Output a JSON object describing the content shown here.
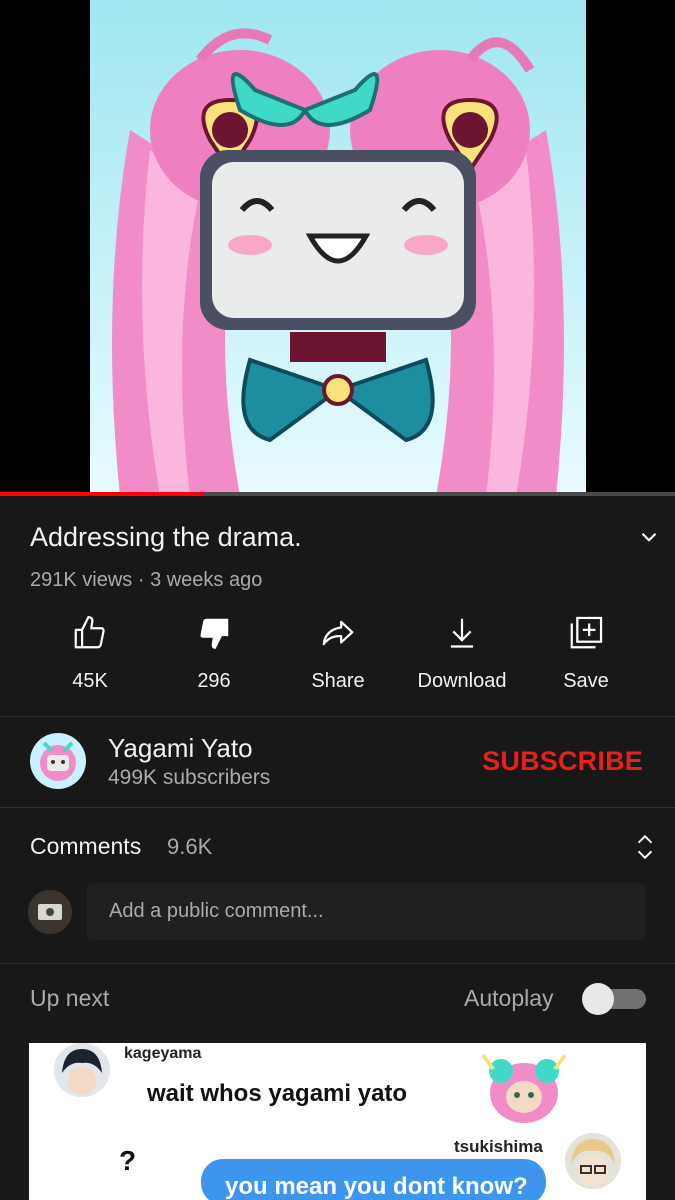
{
  "video": {
    "title": "Addressing the drama.",
    "views": "291K views",
    "age": "3 weeks ago",
    "progress_fraction": 0.3
  },
  "actions": {
    "like_label": "45K",
    "dislike_label": "296",
    "share_label": "Share",
    "download_label": "Download",
    "save_label": "Save"
  },
  "channel": {
    "name": "Yagami Yato",
    "subscribers": "499K subscribers",
    "subscribe_label": "SUBSCRIBE"
  },
  "comments": {
    "title": "Comments",
    "count": "9.6K",
    "placeholder": "Add a public comment..."
  },
  "up_next": {
    "label": "Up next",
    "autoplay_label": "Autoplay",
    "autoplay_on": false,
    "card": {
      "user1": "kageyama",
      "message1": "wait whos yagami yato",
      "question_mark": "?",
      "user2": "tsukishima",
      "message2": "you mean you dont know?"
    }
  },
  "colors": {
    "background": "#181818",
    "progress": "#ff0000",
    "subscribe": "#e62117",
    "chat_bubble": "#3d95ee"
  },
  "icons": {
    "like": "thumb-up-icon",
    "dislike": "thumb-down-icon",
    "share": "share-arrow-icon",
    "download": "download-icon",
    "save": "playlist-add-icon"
  }
}
